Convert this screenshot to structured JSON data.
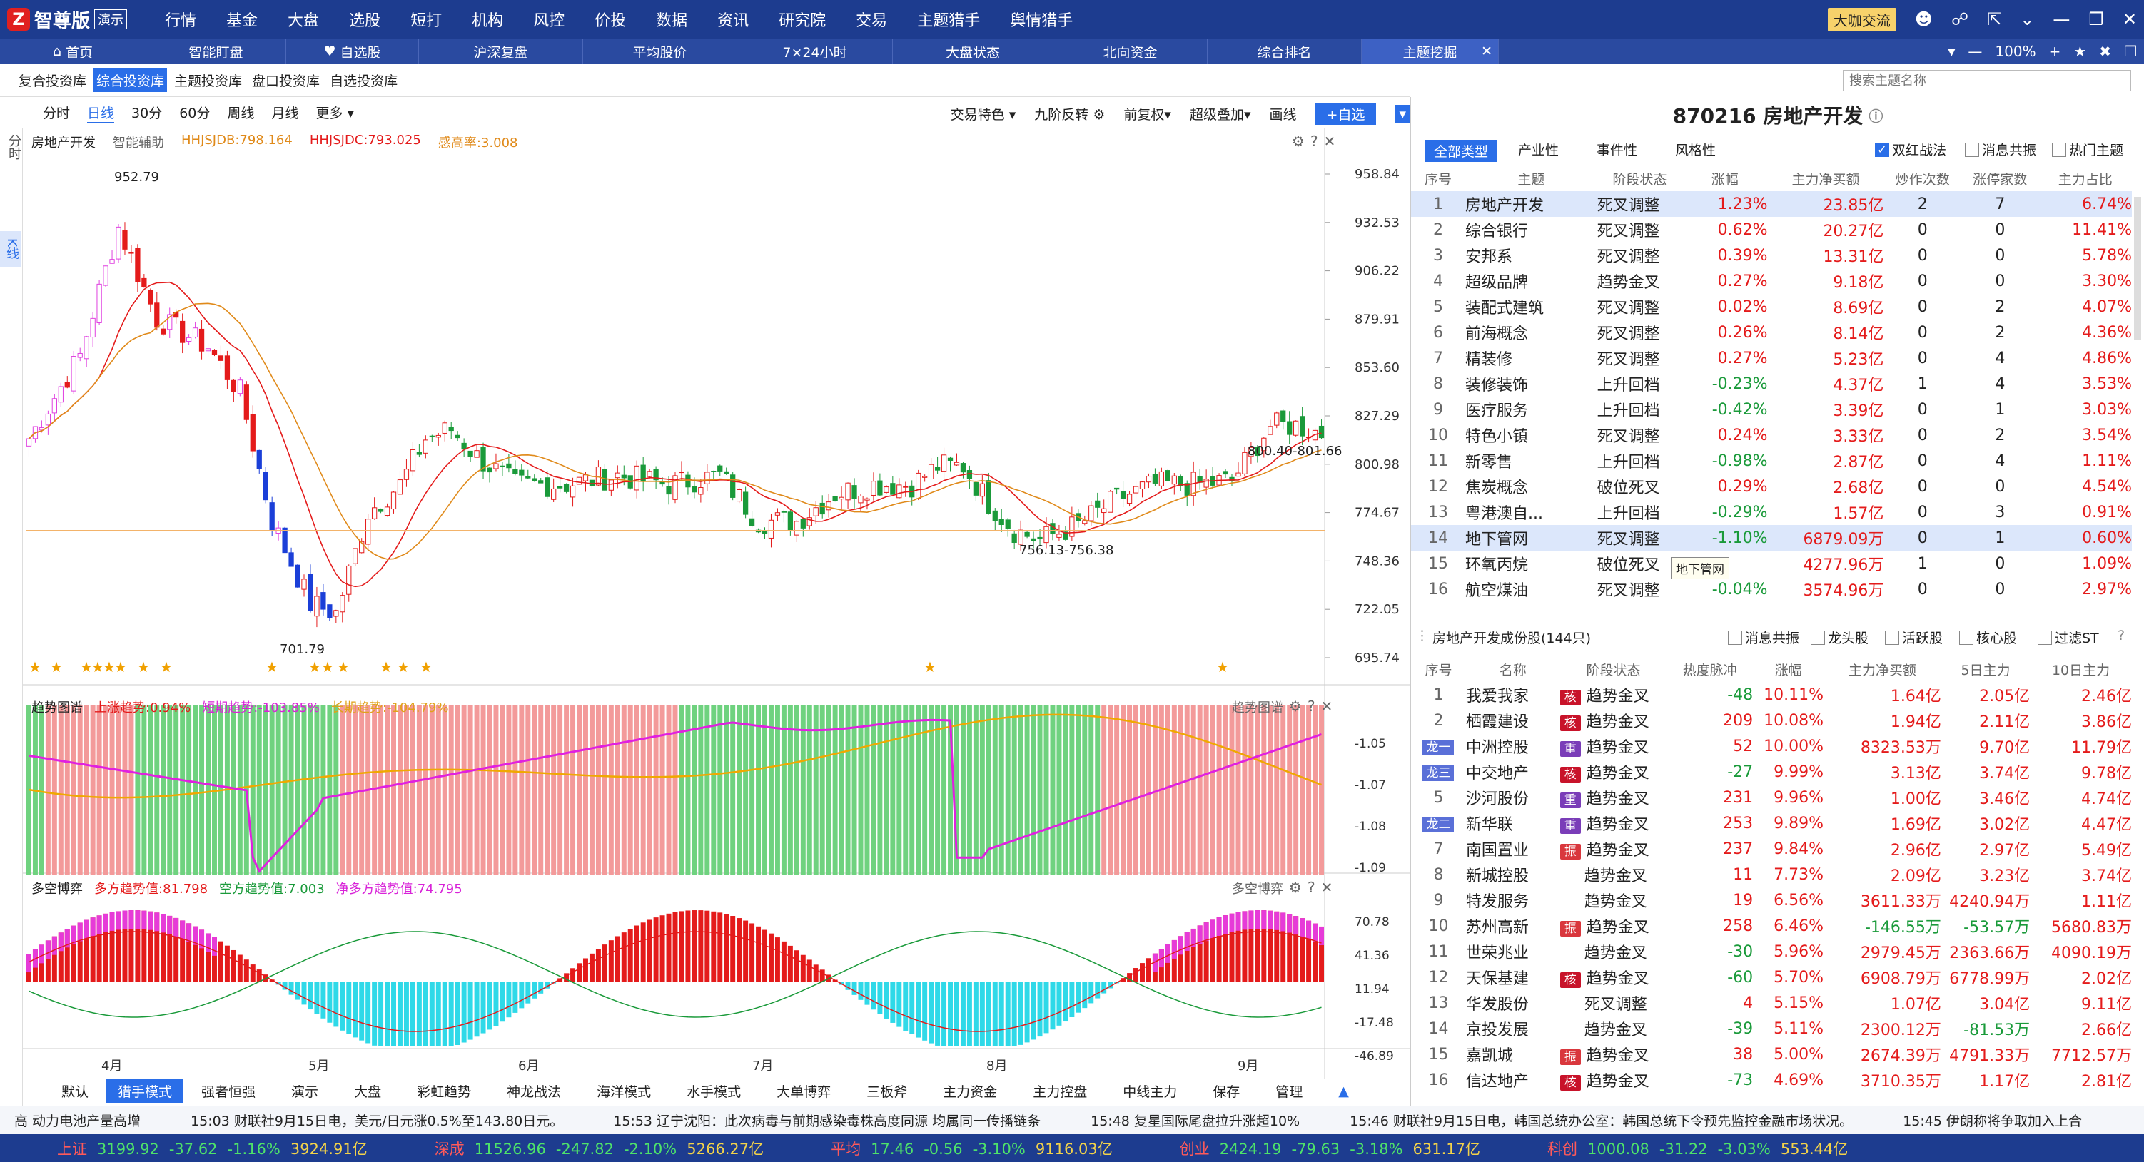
{
  "app": {
    "name": "智尊版",
    "demo": "演示",
    "logo": "Z"
  },
  "menu": [
    "行情",
    "基金",
    "大盘",
    "选股",
    "短打",
    "机构",
    "风控",
    "价投",
    "数据",
    "资讯",
    "研究院",
    "交易",
    "主题猎手",
    "舆情猎手"
  ],
  "titlebar_right": {
    "bigv": "大咖交流"
  },
  "tabs": [
    "首页",
    "智能盯盘",
    "自选股",
    "沪深复盘",
    "平均股价",
    "7×24小时",
    "大盘状态",
    "北向资金",
    "综合排名",
    "主题挖掘"
  ],
  "tabs_right": {
    "zoom": "100%"
  },
  "pool_tabs": [
    "复合投资库",
    "综合投资库",
    "主题投资库",
    "盘口投资库",
    "自选投资库"
  ],
  "search_placeholder": "搜索主题名称",
  "left_strip": {
    "top": "分时",
    "kx": "K线"
  },
  "periods": [
    "分时",
    "日线",
    "30分",
    "60分",
    "周线",
    "月线",
    "更多"
  ],
  "chart_tools": [
    "交易特色",
    "九阶反转",
    "前复权",
    "超级叠加",
    "画线",
    "+自选"
  ],
  "main_legend": {
    "name": "房地产开发",
    "assist": "智能辅助",
    "l1": "HHJSJDB:798.164",
    "l2": "HHJSJDC:793.025",
    "l3": "感高率:3.008"
  },
  "trend_legend": {
    "name": "趋势图谱",
    "a": "上涨趋势:0.94%",
    "b": "短期趋势:-103.85%",
    "c": "长期趋势:-104.79%",
    "tag": "趋势图谱"
  },
  "game_legend": {
    "name": "多空博弈",
    "a": "多方趋势值:81.798",
    "b": "空方趋势值:7.003",
    "c": "净多方趋势值:74.795",
    "tag": "多空博弈"
  },
  "chart_data": {
    "type": "candlestick",
    "ylabels": [
      "958.84",
      "932.53",
      "906.22",
      "879.91",
      "853.60",
      "827.29",
      "800.98",
      "774.67",
      "748.36",
      "722.05",
      "695.74"
    ],
    "trend_ylabels": [
      "-1.05",
      "-1.07",
      "-1.08",
      "-1.09"
    ],
    "game_ylabels": [
      "70.78",
      "41.36",
      "11.94",
      "-17.48",
      "-46.89"
    ],
    "xlabels": [
      "4月",
      "5月",
      "6月",
      "7月",
      "8月",
      "9月"
    ],
    "annotations": [
      "952.79",
      "701.79",
      "756.13-756.38",
      "800.40-801.66"
    ],
    "ylim": [
      695.74,
      958.84
    ]
  },
  "bottom_tabs": [
    "默认",
    "猎手模式",
    "强者恒强",
    "演示",
    "大盘",
    "彩虹趋势",
    "神龙战法",
    "海洋模式",
    "水手模式",
    "大单博弈",
    "三板斧",
    "主力资金",
    "主力控盘",
    "中线主力",
    "保存",
    "管理"
  ],
  "right_title": "870216 房地产开发",
  "filters": [
    "全部类型",
    "产业性",
    "事件性",
    "风格性"
  ],
  "checks": [
    "双红战法",
    "消息共振",
    "热门主题"
  ],
  "theme_headers": [
    "序号",
    "主题",
    "阶段状态",
    "涨幅",
    "主力净买额",
    "炒作次数",
    "涨停家数",
    "主力占比"
  ],
  "themes": [
    [
      "1",
      "房地产开发",
      "死叉调整",
      "1.23%",
      "23.85亿",
      "2",
      "7",
      "6.74%"
    ],
    [
      "2",
      "综合银行",
      "死叉调整",
      "0.62%",
      "20.27亿",
      "0",
      "0",
      "11.41%"
    ],
    [
      "3",
      "安邦系",
      "死叉调整",
      "0.39%",
      "13.31亿",
      "0",
      "0",
      "5.78%"
    ],
    [
      "4",
      "超级品牌",
      "趋势金叉",
      "0.27%",
      "9.18亿",
      "0",
      "0",
      "3.30%"
    ],
    [
      "5",
      "装配式建筑",
      "死叉调整",
      "0.02%",
      "8.69亿",
      "0",
      "2",
      "4.07%"
    ],
    [
      "6",
      "前海概念",
      "死叉调整",
      "0.26%",
      "8.14亿",
      "0",
      "2",
      "4.36%"
    ],
    [
      "7",
      "精装修",
      "死叉调整",
      "0.27%",
      "5.23亿",
      "0",
      "4",
      "4.86%"
    ],
    [
      "8",
      "装修装饰",
      "上升回档",
      "-0.23%",
      "4.37亿",
      "1",
      "4",
      "3.53%"
    ],
    [
      "9",
      "医疗服务",
      "上升回档",
      "-0.42%",
      "3.39亿",
      "0",
      "1",
      "3.03%"
    ],
    [
      "10",
      "特色小镇",
      "死叉调整",
      "0.24%",
      "3.33亿",
      "0",
      "2",
      "3.54%"
    ],
    [
      "11",
      "新零售",
      "上升回档",
      "-0.98%",
      "2.87亿",
      "0",
      "4",
      "1.11%"
    ],
    [
      "12",
      "焦炭概念",
      "破位死叉",
      "0.29%",
      "2.68亿",
      "0",
      "0",
      "4.54%"
    ],
    [
      "13",
      "粤港澳自...",
      "上升回档",
      "-0.29%",
      "1.57亿",
      "0",
      "3",
      "0.91%"
    ],
    [
      "14",
      "地下管网",
      "死叉调整",
      "-1.10%",
      "6879.09万",
      "0",
      "1",
      "0.60%"
    ],
    [
      "15",
      "环氧丙烷",
      "破位死叉",
      "",
      "4277.96万",
      "1",
      "0",
      "1.09%"
    ],
    [
      "16",
      "航空煤油",
      "死叉调整",
      "-0.04%",
      "3574.96万",
      "0",
      "0",
      "2.97%"
    ]
  ],
  "tooltip": "地下管网",
  "cons_title": "房地产开发成份股(144只)",
  "cons_checks": [
    "消息共振",
    "龙头股",
    "活跃股",
    "核心股",
    "过滤ST"
  ],
  "stock_headers": [
    "序号",
    "名称",
    "阶段状态",
    "热度脉冲",
    "涨幅",
    "主力净买额",
    "5日主力",
    "10日主力"
  ],
  "stocks": [
    [
      "1",
      "我爱我家",
      "核",
      "趋势金叉",
      "-48",
      "10.11%",
      "1.64亿",
      "2.05亿",
      "2.46亿",
      ""
    ],
    [
      "2",
      "栖霞建设",
      "核",
      "趋势金叉",
      "209",
      "10.08%",
      "1.94亿",
      "2.11亿",
      "3.86亿",
      ""
    ],
    [
      "龙一",
      "中洲控股",
      "重",
      "趋势金叉",
      "52",
      "10.00%",
      "8323.53万",
      "9.70亿",
      "11.79亿",
      ""
    ],
    [
      "龙三",
      "中交地产",
      "核",
      "趋势金叉",
      "-27",
      "9.99%",
      "3.13亿",
      "3.74亿",
      "9.78亿",
      ""
    ],
    [
      "5",
      "沙河股份",
      "重",
      "趋势金叉",
      "231",
      "9.96%",
      "1.00亿",
      "3.46亿",
      "4.74亿",
      ""
    ],
    [
      "龙二",
      "新华联",
      "重",
      "趋势金叉",
      "253",
      "9.89%",
      "1.69亿",
      "3.02亿",
      "4.47亿",
      ""
    ],
    [
      "7",
      "南国置业",
      "振",
      "趋势金叉",
      "237",
      "9.84%",
      "2.96亿",
      "2.97亿",
      "5.49亿",
      ""
    ],
    [
      "8",
      "新城控股",
      "",
      "趋势金叉",
      "11",
      "7.73%",
      "2.09亿",
      "3.23亿",
      "3.74亿",
      ""
    ],
    [
      "9",
      "特发服务",
      "",
      "趋势金叉",
      "19",
      "6.56%",
      "3611.33万",
      "4240.94万",
      "1.11亿",
      ""
    ],
    [
      "10",
      "苏州高新",
      "振",
      "趋势金叉",
      "258",
      "6.46%",
      "-146.55万",
      "-53.57万",
      "5680.83万",
      ""
    ],
    [
      "11",
      "世荣兆业",
      "",
      "趋势金叉",
      "-30",
      "5.96%",
      "2979.45万",
      "2363.66万",
      "4090.19万",
      ""
    ],
    [
      "12",
      "天保基建",
      "核",
      "趋势金叉",
      "-60",
      "5.70%",
      "6908.79万",
      "6778.99万",
      "2.02亿",
      ""
    ],
    [
      "13",
      "华发股份",
      "",
      "死叉调整",
      "4",
      "5.15%",
      "1.07亿",
      "3.04亿",
      "9.11亿",
      ""
    ],
    [
      "14",
      "京投发展",
      "",
      "趋势金叉",
      "-39",
      "5.11%",
      "2300.12万",
      "-81.53万",
      "2.66亿",
      ""
    ],
    [
      "15",
      "嘉凯城",
      "振",
      "趋势金叉",
      "38",
      "5.00%",
      "2674.39万",
      "4791.33万",
      "7712.57万",
      ""
    ],
    [
      "16",
      "信达地产",
      "核",
      "趋势金叉",
      "-73",
      "4.69%",
      "3710.35万",
      "1.17亿",
      "2.81亿",
      ""
    ]
  ],
  "news": [
    "高 动力电池产量高增",
    "15:03 财联社9月15日电，美元/日元涨0.5%至143.80日元。",
    "15:53 辽宁沈阳：此次病毒与前期感染毒株高度同源 均属同一传播链条",
    "15:48 复星国际尾盘拉升涨超10%",
    "15:46 财联社9月15日电，韩国总统办公室：韩国总统下令预先监控金融市场状况。",
    "15:45 伊朗称将争取加入上合"
  ],
  "status": [
    {
      "n": "上证",
      "v": "3199.92",
      "c": "-37.62",
      "p": "-1.16%",
      "a": "3924.91亿"
    },
    {
      "n": "深成",
      "v": "11526.96",
      "c": "-247.82",
      "p": "-2.10%",
      "a": "5266.27亿"
    },
    {
      "n": "平均",
      "v": "17.46",
      "c": "-0.56",
      "p": "-3.10%",
      "a": "9116.03亿"
    },
    {
      "n": "创业",
      "v": "2424.19",
      "c": "-79.63",
      "p": "-3.18%",
      "a": "631.17亿"
    },
    {
      "n": "科创",
      "v": "1000.08",
      "c": "-31.22",
      "p": "-3.03%",
      "a": "553.44亿"
    }
  ]
}
